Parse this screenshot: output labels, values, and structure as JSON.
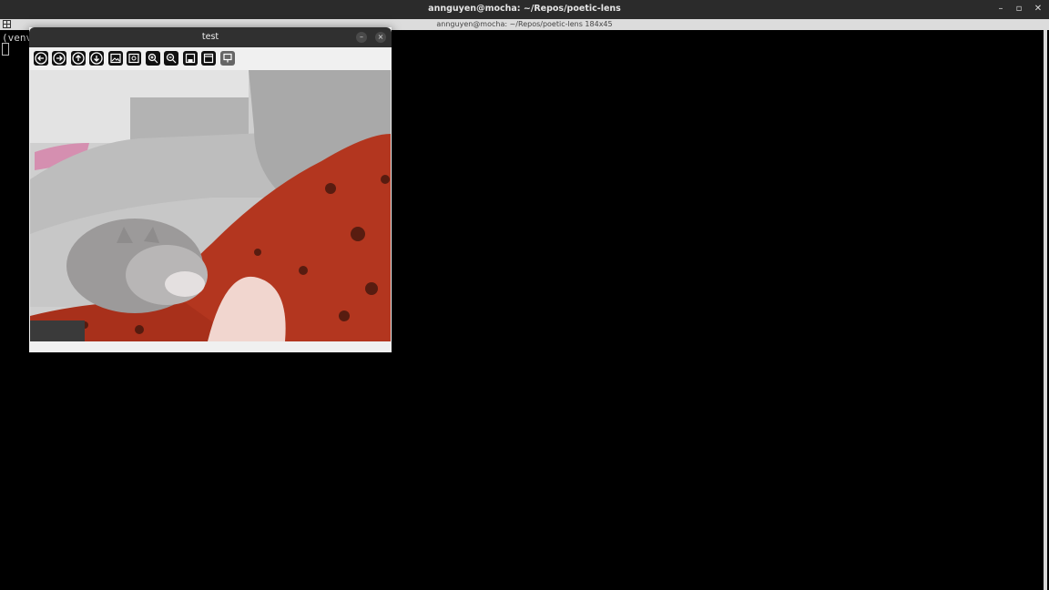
{
  "terminal": {
    "window_title": "annguyen@mocha: ~/Repos/poetic-lens",
    "tab_label": "annguyen@mocha: ~/Repos/poetic-lens 184x45",
    "prompt_text": "(venv",
    "controls": {
      "minimize": "–",
      "maximize": "▫",
      "close": "✕"
    }
  },
  "viewer": {
    "title": "test",
    "controls": {
      "minimize": "–",
      "close": "×"
    },
    "toolbar": [
      {
        "name": "back-icon"
      },
      {
        "name": "forward-icon"
      },
      {
        "name": "up-icon"
      },
      {
        "name": "down-icon"
      },
      {
        "name": "image-icon"
      },
      {
        "name": "image-settings-icon"
      },
      {
        "name": "zoom-in-icon"
      },
      {
        "name": "zoom-out-icon"
      },
      {
        "name": "save-icon"
      },
      {
        "name": "properties-icon"
      },
      {
        "name": "options-icon"
      }
    ]
  },
  "colors": {
    "shirt": "#b23a24",
    "couch": "#c9c9c9",
    "cat": "#9c9a9a",
    "skin": "#f1d6cf"
  }
}
